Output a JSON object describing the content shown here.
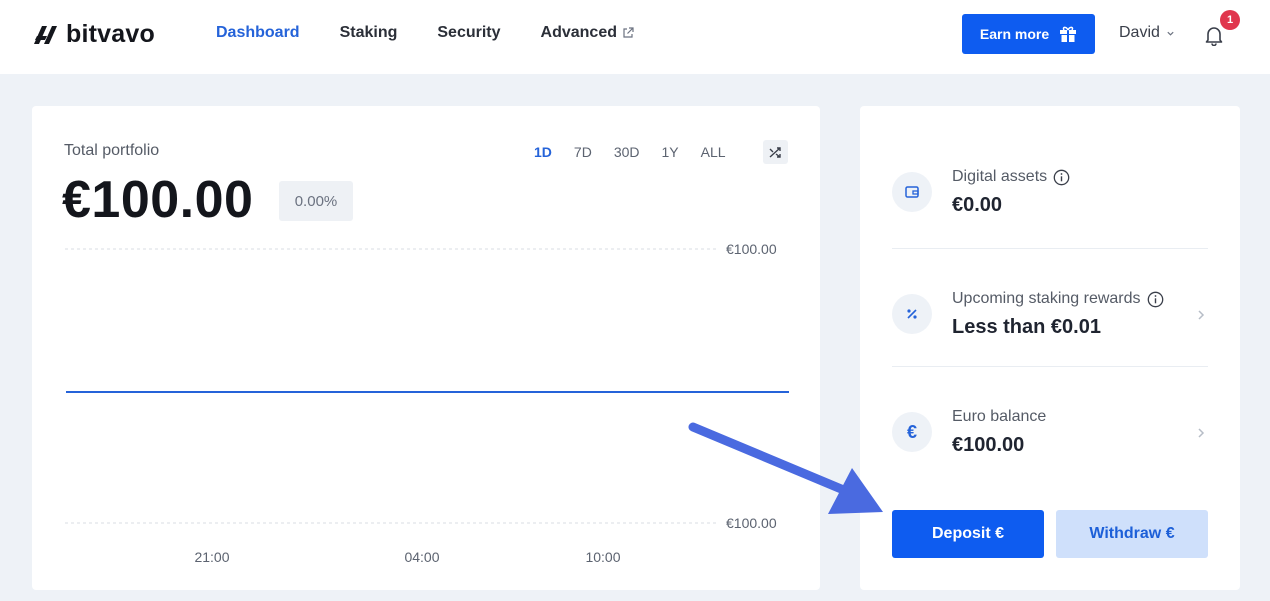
{
  "brand": {
    "name": "bitvavo"
  },
  "nav": {
    "items": [
      {
        "label": "Dashboard",
        "active": true
      },
      {
        "label": "Staking",
        "active": false
      },
      {
        "label": "Security",
        "active": false
      },
      {
        "label": "Advanced",
        "active": false,
        "external": true
      }
    ]
  },
  "header": {
    "earn_label": "Earn more",
    "user_name": "David",
    "notification_count": "1"
  },
  "portfolio": {
    "label": "Total portfolio",
    "value": "€100.00",
    "change": "0.00%",
    "ranges": [
      "1D",
      "7D",
      "30D",
      "1Y",
      "ALL"
    ],
    "active_range": "1D"
  },
  "chart_data": {
    "type": "line",
    "title": "",
    "xlabel": "",
    "ylabel": "",
    "x_ticks": [
      "21:00",
      "04:00",
      "10:00"
    ],
    "y_ticks": [
      "€100.00",
      "€100.00"
    ],
    "series": [
      {
        "values": [
          100.0,
          100.0
        ]
      }
    ],
    "ylim": [
      100.0,
      100.0
    ],
    "grid": true,
    "line_color": "#2563d9"
  },
  "assets": [
    {
      "icon": "wallet-icon",
      "label": "Digital assets",
      "value": "€0.00",
      "info": true,
      "chevron": false
    },
    {
      "icon": "percent-icon",
      "label": "Upcoming staking rewards",
      "value": "Less than €0.01",
      "info": true,
      "chevron": true
    },
    {
      "icon": "euro-icon",
      "label": "Euro balance",
      "value": "€100.00",
      "info": false,
      "chevron": true
    }
  ],
  "actions": {
    "deposit_label": "Deposit €",
    "withdraw_label": "Withdraw €"
  },
  "colors": {
    "accent": "#0e5cf0",
    "accent_light": "#cfe0fb",
    "badge": "#e0364d",
    "annotation_arrow": "#4a6ae0"
  }
}
